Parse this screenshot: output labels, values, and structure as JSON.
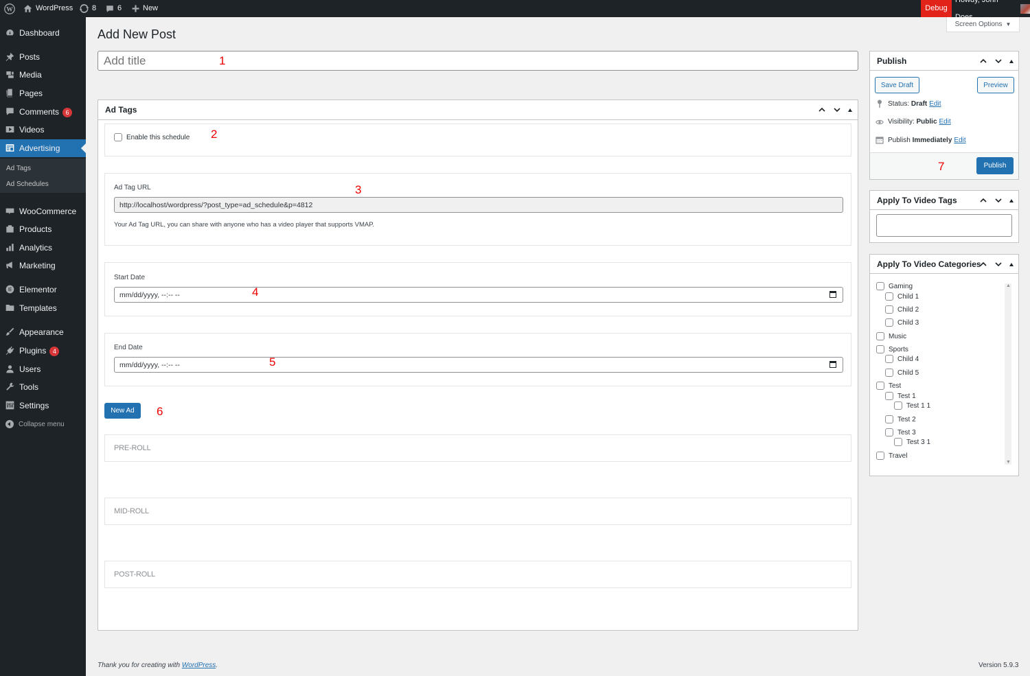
{
  "admin_bar": {
    "site_name": "WordPress",
    "updates_count": "8",
    "comments_count": "6",
    "new_label": "New",
    "debug_label": "Debug",
    "howdy": "Howdy, John Does"
  },
  "sidebar": {
    "items": [
      {
        "label": "Dashboard",
        "icon": "dashboard-icon"
      },
      {
        "label": "Posts",
        "icon": "pin-icon"
      },
      {
        "label": "Media",
        "icon": "media-icon"
      },
      {
        "label": "Pages",
        "icon": "pages-icon"
      },
      {
        "label": "Comments",
        "icon": "comment-icon",
        "badge": "6"
      },
      {
        "label": "Videos",
        "icon": "video-icon"
      },
      {
        "label": "Advertising",
        "icon": "advertising-icon",
        "active": true
      },
      {
        "label": "WooCommerce",
        "icon": "woocommerce-icon"
      },
      {
        "label": "Products",
        "icon": "products-icon"
      },
      {
        "label": "Analytics",
        "icon": "analytics-icon"
      },
      {
        "label": "Marketing",
        "icon": "megaphone-icon"
      },
      {
        "label": "Elementor",
        "icon": "elementor-icon"
      },
      {
        "label": "Templates",
        "icon": "folder-icon"
      },
      {
        "label": "Appearance",
        "icon": "brush-icon"
      },
      {
        "label": "Plugins",
        "icon": "plugin-icon",
        "badge": "4"
      },
      {
        "label": "Users",
        "icon": "user-icon"
      },
      {
        "label": "Tools",
        "icon": "wrench-icon"
      },
      {
        "label": "Settings",
        "icon": "settings-icon"
      }
    ],
    "submenu": [
      "Ad Tags",
      "Ad Schedules"
    ],
    "collapse_label": "Collapse menu"
  },
  "page": {
    "title": "Add New Post",
    "screen_options": "Screen Options",
    "title_placeholder": "Add title"
  },
  "annotations": [
    "1",
    "2",
    "3",
    "4",
    "5",
    "6",
    "7"
  ],
  "ad_tags_box": {
    "title": "Ad Tags",
    "enable_schedule_label": "Enable this schedule",
    "ad_tag_url_label": "Ad Tag URL",
    "ad_tag_url_value": "http://localhost/wordpress/?post_type=ad_schedule&p=4812",
    "ad_tag_url_help": "Your Ad Tag URL, you can share with anyone who has a video player that supports VMAP.",
    "start_date_label": "Start Date",
    "start_date_placeholder": "mm/dd/yyyy, --:-- --",
    "end_date_label": "End Date",
    "end_date_placeholder": "mm/dd/yyyy, --:-- --",
    "new_ad_button": "New Ad",
    "rolls": [
      "PRE-ROLL",
      "MID-ROLL",
      "POST-ROLL"
    ]
  },
  "publish_box": {
    "title": "Publish",
    "save_draft": "Save Draft",
    "preview": "Preview",
    "status_label": "Status:",
    "status_value": "Draft",
    "visibility_label": "Visibility:",
    "visibility_value": "Public",
    "publish_label": "Publish",
    "publish_value": "Immediately",
    "edit_link": "Edit",
    "publish_button": "Publish"
  },
  "video_tags_box": {
    "title": "Apply To Video Tags",
    "input_value": ""
  },
  "video_categories_box": {
    "title": "Apply To Video Categories",
    "categories": [
      {
        "label": "Gaming",
        "level": 0
      },
      {
        "label": "Child 1",
        "level": 1
      },
      {
        "label": "Child 2",
        "level": 1
      },
      {
        "label": "Child 3",
        "level": 1
      },
      {
        "label": "Music",
        "level": 0
      },
      {
        "label": "Sports",
        "level": 0
      },
      {
        "label": "Child 4",
        "level": 1
      },
      {
        "label": "Child 5",
        "level": 1
      },
      {
        "label": "Test",
        "level": 0
      },
      {
        "label": "Test 1",
        "level": 1
      },
      {
        "label": "Test 1 1",
        "level": 2
      },
      {
        "label": "Test 2",
        "level": 1
      },
      {
        "label": "Test 3",
        "level": 1
      },
      {
        "label": "Test 3 1",
        "level": 2
      },
      {
        "label": "Travel",
        "level": 0
      }
    ]
  },
  "footer": {
    "thanks_prefix": "Thank you for creating with",
    "thanks_link": "WordPress",
    "thanks_suffix": ".",
    "version": "Version 5.9.3"
  },
  "colors": {
    "accent": "#2271b1",
    "admin_bar": "#1d2327",
    "debug": "#e2231a",
    "badge": "#d63638",
    "annotation": "#ee0000"
  }
}
